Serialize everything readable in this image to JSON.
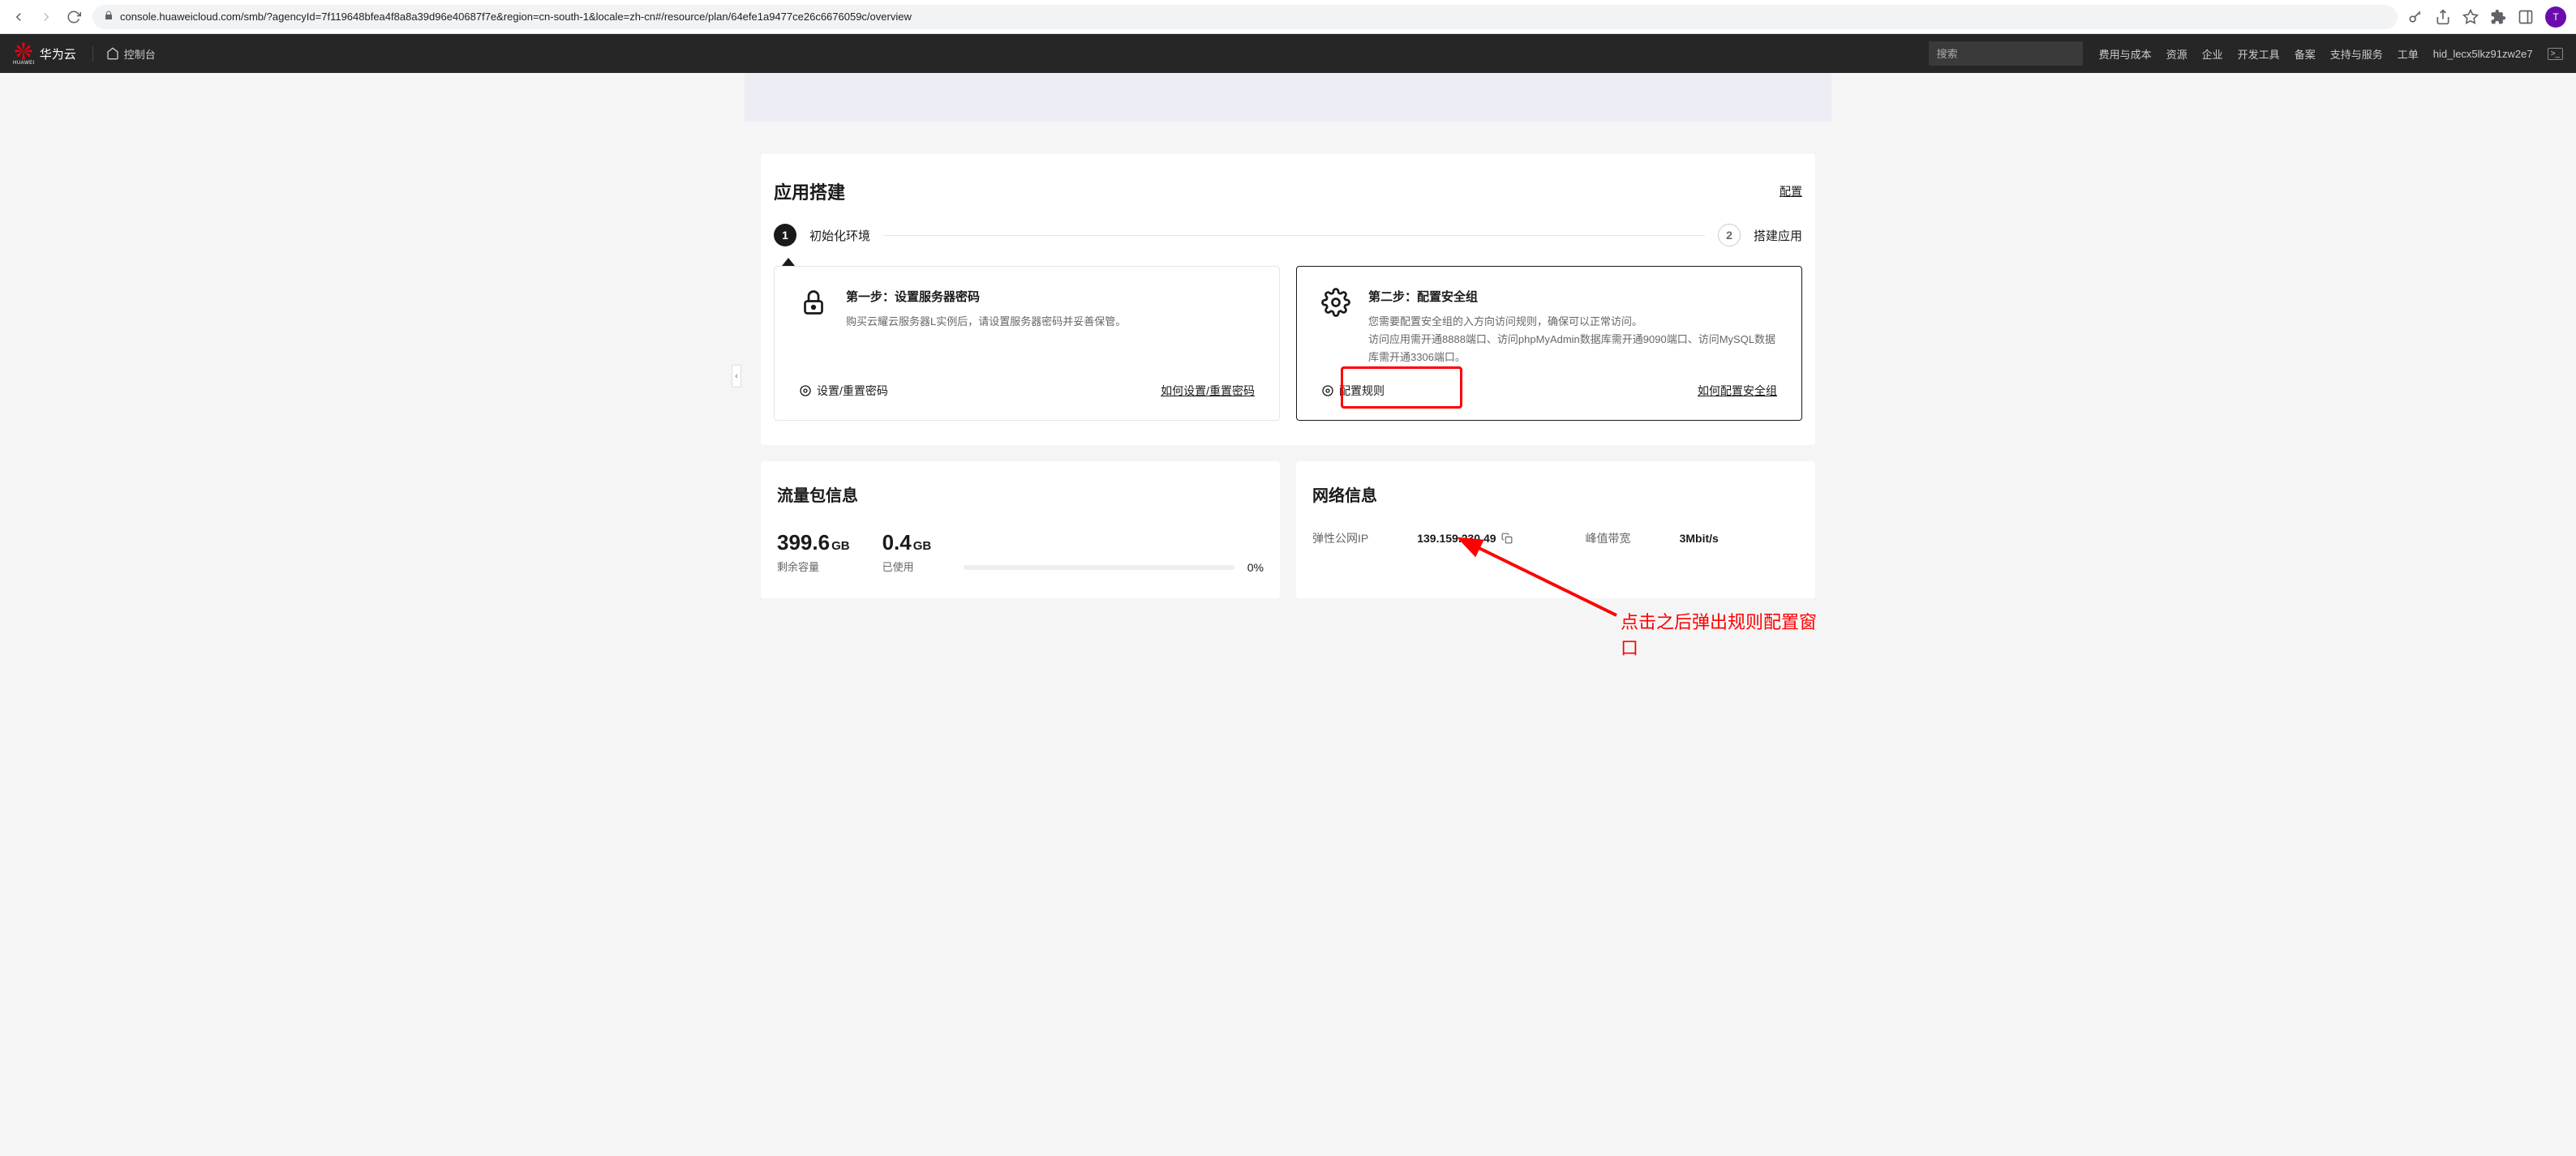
{
  "browser": {
    "url": "console.huaweicloud.com/smb/?agencyId=7f119648bfea4f8a8a39d96e40687f7e&region=cn-south-1&locale=zh-cn#/resource/plan/64efe1a9477ce26c6676059c/overview",
    "avatar_initial": "T"
  },
  "header": {
    "brand": "华为云",
    "logo_label": "HUAWEI",
    "console": "控制台",
    "search_placeholder": "搜索",
    "links": {
      "cost": "费用与成本",
      "resource": "资源",
      "enterprise": "企业",
      "devtools": "开发工具",
      "backup": "备案",
      "support": "支持与服务",
      "workorder": "工单",
      "user": "hid_lecx5lkz91zw2e7"
    }
  },
  "appBuild": {
    "title": "应用搭建",
    "config_link": "配置",
    "steps": {
      "s1_num": "1",
      "s1_label": "初始化环境",
      "s2_num": "2",
      "s2_label": "搭建应用"
    },
    "card1": {
      "title": "第一步：设置服务器密码",
      "desc": "购买云耀云服务器L实例后，请设置服务器密码并妥善保管。",
      "action": "设置/重置密码",
      "help": "如何设置/重置密码"
    },
    "card2": {
      "title": "第二步：配置安全组",
      "desc_l1": "您需要配置安全组的入方向访问规则，确保可以正常访问。",
      "desc_l2": "访问应用需开通8888端口、访问phpMyAdmin数据库需开通9090端口、访问MySQL数据库需开通3306端口。",
      "action": "配置规则",
      "help": "如何配置安全组"
    }
  },
  "traffic": {
    "title": "流量包信息",
    "remain_value": "399.6",
    "remain_unit": "GB",
    "remain_label": "剩余容量",
    "used_value": "0.4",
    "used_unit": "GB",
    "used_label": "已使用",
    "progress_pct": "0%"
  },
  "network": {
    "title": "网络信息",
    "eip_label": "弹性公网IP",
    "eip_value": "139.159.230.49",
    "bw_label": "峰值带宽",
    "bw_value": "3Mbit/s"
  },
  "annotation": {
    "text": "点击之后弹出规则配置窗口"
  }
}
